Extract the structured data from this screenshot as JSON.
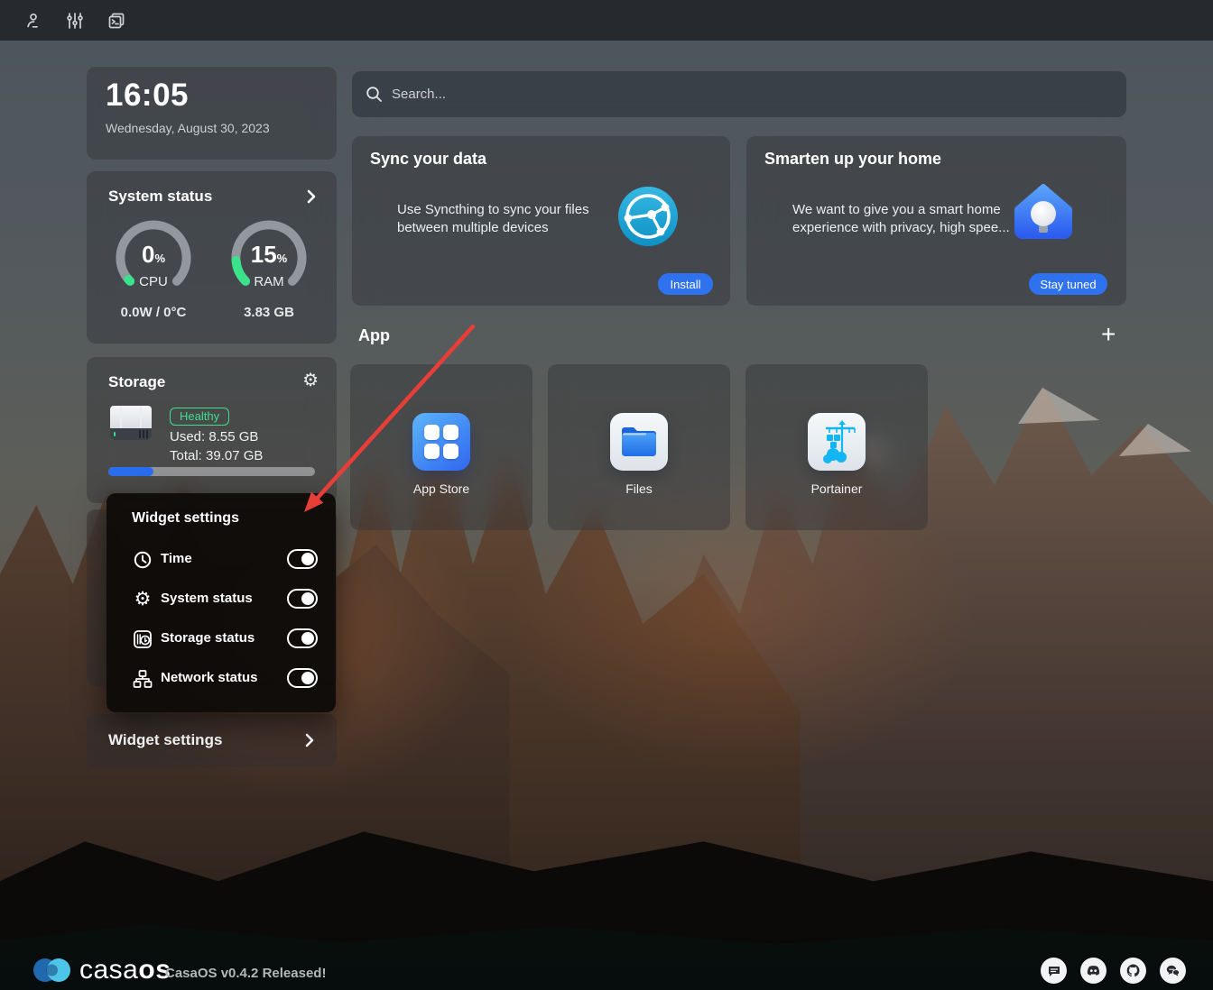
{
  "topbar": {
    "icons": [
      {
        "name": "user-icon"
      },
      {
        "name": "filters-icon"
      },
      {
        "name": "terminal-icon"
      }
    ]
  },
  "clock": {
    "time": "16:05",
    "date": "Wednesday, August 30, 2023"
  },
  "system_status": {
    "title": "System status",
    "gauges": [
      {
        "value": "0",
        "unit": "%",
        "label": "CPU",
        "sub": "0.0W / 0°C",
        "percent": 0
      },
      {
        "value": "15",
        "unit": "%",
        "label": "RAM",
        "sub": "3.83 GB",
        "percent": 15
      }
    ]
  },
  "storage": {
    "title": "Storage",
    "health_badge": "Healthy",
    "used_label": "Used: 8.55 GB",
    "total_label": "Total: 39.07 GB",
    "used_percent": 22
  },
  "widget_popup": {
    "title": "Widget settings",
    "items": [
      {
        "icon": "clock-icon",
        "label": "Time",
        "enabled": true
      },
      {
        "icon": "gear-icon",
        "label": "System status",
        "enabled": true
      },
      {
        "icon": "storage-icon",
        "label": "Storage status",
        "enabled": true
      },
      {
        "icon": "network-icon",
        "label": "Network status",
        "enabled": true
      }
    ]
  },
  "widget_settings_bar": {
    "label": "Widget settings"
  },
  "search": {
    "placeholder": "Search..."
  },
  "promos": [
    {
      "title": "Sync your data",
      "description": [
        "Use Syncthing to sync your files",
        "between multiple devices"
      ],
      "button": "Install",
      "icon": "syncthing-icon"
    },
    {
      "title": "Smarten up your home",
      "description": [
        "We want to give you a smart home",
        "experience with privacy, high spee..."
      ],
      "button": "Stay tuned",
      "icon": "smart-home-icon"
    }
  ],
  "apps": {
    "section_title": "App",
    "add_button": "+",
    "tiles": [
      {
        "label": "App Store",
        "icon": "app-store-icon"
      },
      {
        "label": "Files",
        "icon": "files-icon"
      },
      {
        "label": "Portainer",
        "icon": "portainer-icon"
      }
    ]
  },
  "footer": {
    "brand_casa": "casa",
    "brand_os": "os",
    "release_note": "CasaOS v0.4.2 Released!",
    "social_icons": [
      "message-icon",
      "discord-icon",
      "github-icon",
      "chat-icon"
    ]
  },
  "colors": {
    "accent_blue": "#2e72f0",
    "gauge_green": "#3ae28c",
    "healthy_green": "#3fdf8e",
    "storage_bar_blue": "#2b6df0",
    "arrow_red": "#e83e38",
    "syncthing_blue": "#1ba6d3",
    "topbar_bg": "#26292d"
  }
}
